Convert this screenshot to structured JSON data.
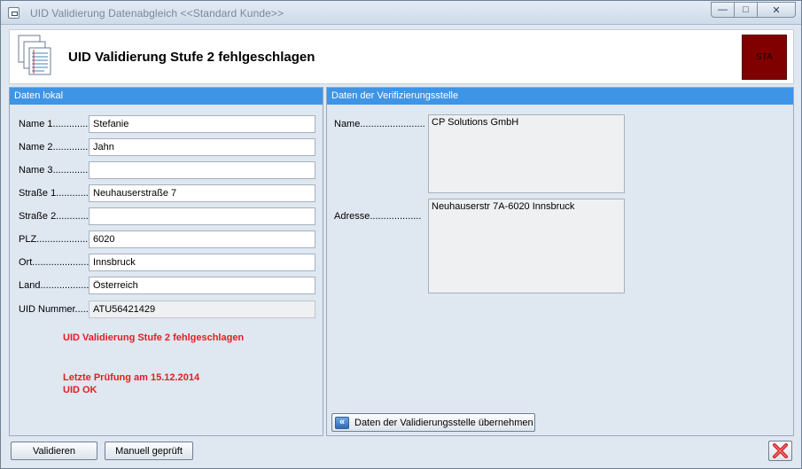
{
  "window": {
    "title": "UID Validierung Datenabgleich  <<Standard Kunde>>",
    "controls": {
      "minimize": "—",
      "restore": "□",
      "close": "✕"
    }
  },
  "header": {
    "title": "UID Validierung Stufe 2 fehlgeschlagen",
    "badge": "STA",
    "badge_color": "#800000"
  },
  "left_panel": {
    "title": "Daten lokal",
    "fields": [
      {
        "label": "Name 1..............",
        "value": "Stefanie"
      },
      {
        "label": "Name 2..............",
        "value": "Jahn"
      },
      {
        "label": "Name 3..............",
        "value": ""
      },
      {
        "label": "Straße 1..............",
        "value": "Neuhauserstraße 7"
      },
      {
        "label": "Straße 2..............",
        "value": ""
      },
      {
        "label": "PLZ.......................",
        "value": "6020"
      },
      {
        "label": "Ort.......................",
        "value": "Innsbruck"
      },
      {
        "label": "Land......................",
        "value": "Österreich"
      },
      {
        "label": "UID Nummer..........",
        "value": "ATU56421429"
      }
    ],
    "status_message": "UID Validierung Stufe 2 fehlgeschlagen",
    "last_check": "Letzte Prüfung am 15.12.2014",
    "last_result": "UID OK"
  },
  "right_panel": {
    "title": "Daten der Verifizierungsstelle",
    "name_label": "Name........................",
    "name_value": "CP Solutions GmbH",
    "address_label": "Adresse...................",
    "address_value": "Neuhauserstr 7A-6020 Innsbruck",
    "take_button": "Daten der Validierungsstelle übernehmen",
    "take_icon": "«"
  },
  "footer": {
    "validate_button": "Validieren",
    "manual_button": "Manuell geprüft",
    "close_icon_color": "#e03030"
  },
  "colors": {
    "panel_header": "#3e95e6",
    "error_text": "#e02020",
    "window_bg": "#dfe7f1"
  }
}
